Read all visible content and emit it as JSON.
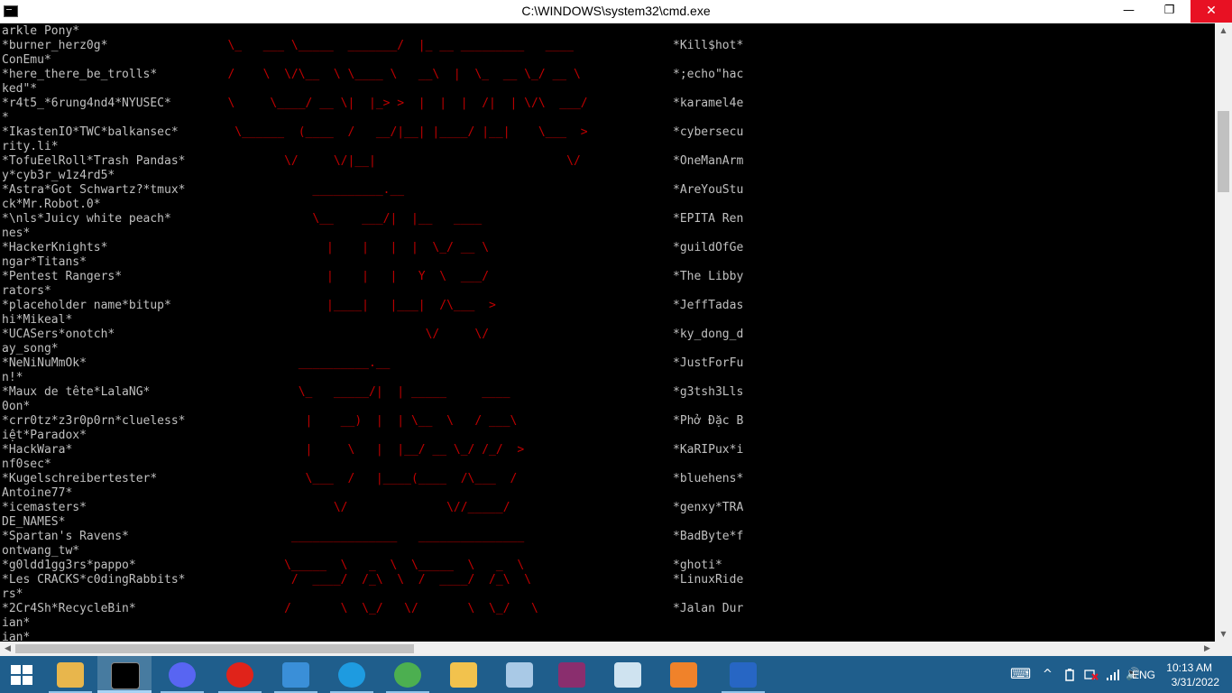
{
  "window": {
    "title": "C:\\WINDOWS\\system32\\cmd.exe",
    "minimize_glyph": "—",
    "maximize_glyph": "❐",
    "close_glyph": "✕"
  },
  "console_lines": [
    {
      "left": "arkle Pony*",
      "art": "",
      "right": ""
    },
    {
      "left": "*burner_herz0g*",
      "art": "                                \\_   ___ \\_____  _______/  |_ __ _________   ____",
      "right": "*Kill$hot*"
    },
    {
      "left": "ConEmu*",
      "art": "",
      "right": ""
    },
    {
      "left": "*here_there_be_trolls*",
      "art": "                                /    \\  \\/\\__  \\ \\____ \\   __\\  |  \\_  __ \\_/ __ \\",
      "right": "*;echo\"hac"
    },
    {
      "left": "ked\"*",
      "art": "",
      "right": ""
    },
    {
      "left": "*r4t5_*6rung4nd4*NYUSEC*",
      "art": "                                \\     \\____/ __ \\|  |_> >  |  |  |  /|  | \\/\\  ___/",
      "right": "*karamel4e"
    },
    {
      "left": "*",
      "art": "",
      "right": ""
    },
    {
      "left": "*IkastenIO*TWC*balkansec*",
      "art": "                                 \\______  (____  /   __/|__| |____/ |__|    \\___  >",
      "right": "*cybersecu"
    },
    {
      "left": "rity.li*",
      "art": "",
      "right": ""
    },
    {
      "left": "*TofuEelRoll*Trash Pandas*",
      "art": "                                        \\/     \\/|__|                           \\/",
      "right": "*OneManArm"
    },
    {
      "left": "y*cyb3r_w1z4rd5*",
      "art": "",
      "right": ""
    },
    {
      "left": "*Astra*Got Schwartz?*tmux*",
      "art": "                                            __________.__",
      "right": "*AreYouStu"
    },
    {
      "left": "ck*Mr.Robot.0*",
      "art": "",
      "right": ""
    },
    {
      "left": "*\\nls*Juicy white peach*",
      "art": "                                            \\__    ___/|  |__   ____",
      "right": "*EPITA Ren"
    },
    {
      "left": "nes*",
      "art": "",
      "right": ""
    },
    {
      "left": "*HackerKnights*",
      "art": "                                              |    |   |  |  \\_/ __ \\",
      "right": "*guildOfGe"
    },
    {
      "left": "ngar*Titans*",
      "art": "",
      "right": ""
    },
    {
      "left": "*Pentest Rangers*",
      "art": "                                              |    |   |   Y  \\  ___/",
      "right": "*The Libby"
    },
    {
      "left": "rators*",
      "art": "",
      "right": ""
    },
    {
      "left": "*placeholder name*bitup*",
      "art": "                                              |____|   |___|  /\\___  >",
      "right": "*JeffTadas"
    },
    {
      "left": "hi*Mikeal*",
      "art": "",
      "right": ""
    },
    {
      "left": "*UCASers*onotch*",
      "art": "                                                            \\/     \\/",
      "right": "*ky_dong_d"
    },
    {
      "left": "ay_song*",
      "art": "",
      "right": ""
    },
    {
      "left": "*NeNiNuMmOk*",
      "art": "                                          __________.__",
      "right": "*JustForFu"
    },
    {
      "left": "n!*",
      "art": "",
      "right": ""
    },
    {
      "left": "*Maux de tête*LalaNG*",
      "art": "                                          \\_   _____/|  | _____     ____",
      "right": "*g3tsh3Lls"
    },
    {
      "left": "0on*",
      "art": "",
      "right": ""
    },
    {
      "left": "*crr0tz*z3r0p0rn*clueless*",
      "art": "                                           |    __)  |  | \\__  \\   / ___\\",
      "right": "*Phở Đặc B"
    },
    {
      "left": "iệt*Paradox*",
      "art": "",
      "right": ""
    },
    {
      "left": "*HackWara*",
      "art": "                                           |     \\   |  |__/ __ \\_/ /_/  >",
      "right": "*KaRIPux*i"
    },
    {
      "left": "nf0sec*",
      "art": "",
      "right": ""
    },
    {
      "left": "*Kugelschreibertester*",
      "art": "                                           \\___  /   |____(____  /\\___  /",
      "right": "*bluehens*"
    },
    {
      "left": "Antoine77*",
      "art": "",
      "right": ""
    },
    {
      "left": "*icemasters*",
      "art": "                                               \\/              \\//_____/",
      "right": "*genxy*TRA"
    },
    {
      "left": "DE_NAMES*",
      "art": "",
      "right": ""
    },
    {
      "left": "*Spartan's Ravens*",
      "art": "                                         _______________   _______________",
      "right": "*BadByte*f"
    },
    {
      "left": "ontwang_tw*",
      "art": "",
      "right": ""
    },
    {
      "left": "*g0ldd1gg3rs*pappo*",
      "art": "                                        \\_____  \\   _  \\  \\_____  \\   _  \\",
      "right": "*ghoti*"
    },
    {
      "left": "*Les CRACKS*c0dingRabbits*",
      "art": "                                         /  ____/  /_\\  \\  /  ____/  /_\\  \\",
      "right": "*LinuxRide"
    },
    {
      "left": "rs*",
      "art": "",
      "right": ""
    },
    {
      "left": "*2Cr4Sh*RecycleBin*",
      "art": "                                        /       \\  \\_/   \\/       \\  \\_/   \\",
      "right": "*Jalan Dur"
    },
    {
      "left": "ian*",
      "art": "",
      "right": ""
    },
    {
      "left": "ian*",
      "art": "",
      "right": ""
    }
  ],
  "scrollbars": {
    "up": "▲",
    "down": "▼",
    "left": "◀",
    "right": "▶"
  },
  "taskbar": {
    "apps": [
      {
        "name": "File Explorer",
        "color": "#e8b64c"
      },
      {
        "name": "Command Prompt",
        "color": "#000000"
      },
      {
        "name": "Discord",
        "color": "#5865f2"
      },
      {
        "name": "Opera",
        "color": "#e0231a"
      },
      {
        "name": "Vector editor",
        "color": "#3a8fd8"
      },
      {
        "name": "Microsoft Edge",
        "color": "#1e9be0"
      },
      {
        "name": "Google Chrome",
        "color": "#4caf50"
      },
      {
        "name": "Paint",
        "color": "#f2c24d"
      },
      {
        "name": "Calculator",
        "color": "#a9c9e6"
      },
      {
        "name": "WinRAR",
        "color": "#8a2e6e"
      },
      {
        "name": "Notes",
        "color": "#cfe3f0"
      },
      {
        "name": "Media Player",
        "color": "#f0822a"
      },
      {
        "name": "PowerShell",
        "color": "#2766c4"
      }
    ],
    "tray": {
      "language": "ENG",
      "time": "10:13 AM",
      "date": "3/31/2022",
      "keyboard_glyph": "⌨",
      "show_hidden_glyph": "^",
      "volume_glyph": "🔊"
    }
  }
}
